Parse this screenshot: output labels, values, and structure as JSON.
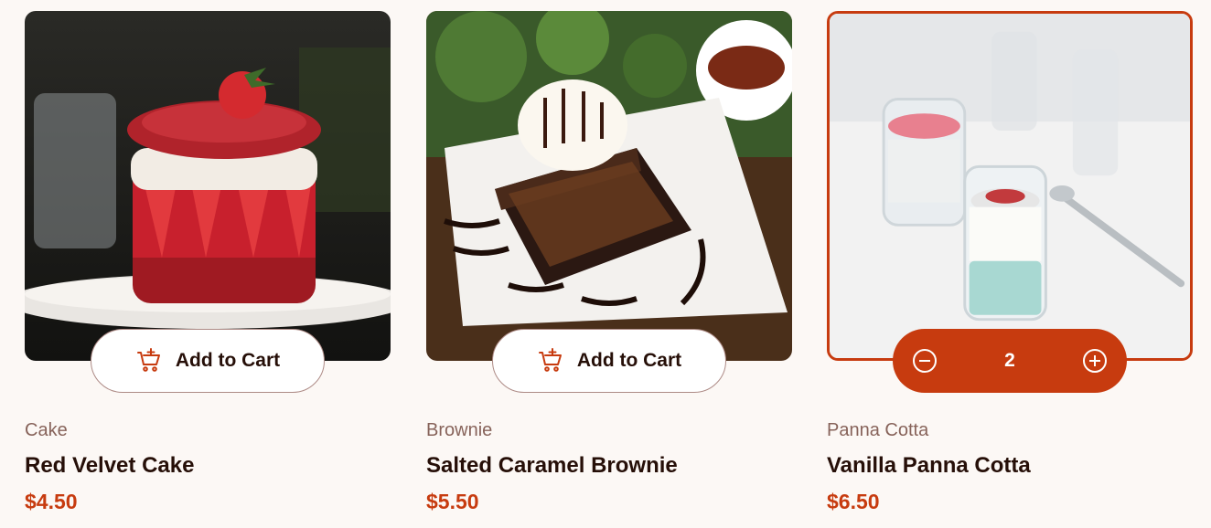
{
  "products": [
    {
      "category": "Cake",
      "name": "Red Velvet Cake",
      "price": "$4.50",
      "button_label": "Add to Cart",
      "image": "red-velvet-cake-photo"
    },
    {
      "category": "Brownie",
      "name": "Salted Caramel Brownie",
      "price": "$5.50",
      "button_label": "Add to Cart",
      "image": "salted-caramel-brownie-photo"
    },
    {
      "category": "Panna Cotta",
      "name": "Vanilla Panna Cotta",
      "price": "$6.50",
      "quantity": "2",
      "image": "vanilla-panna-cotta-photo",
      "selected": true
    }
  ],
  "colors": {
    "accent": "#C73B0F",
    "text_dark": "#260F08",
    "text_muted": "#87635A",
    "background": "#FCF8F5"
  },
  "icons": {
    "add_to_cart": "add-to-cart-icon",
    "decrement": "minus-circle-icon",
    "increment": "plus-circle-icon"
  }
}
